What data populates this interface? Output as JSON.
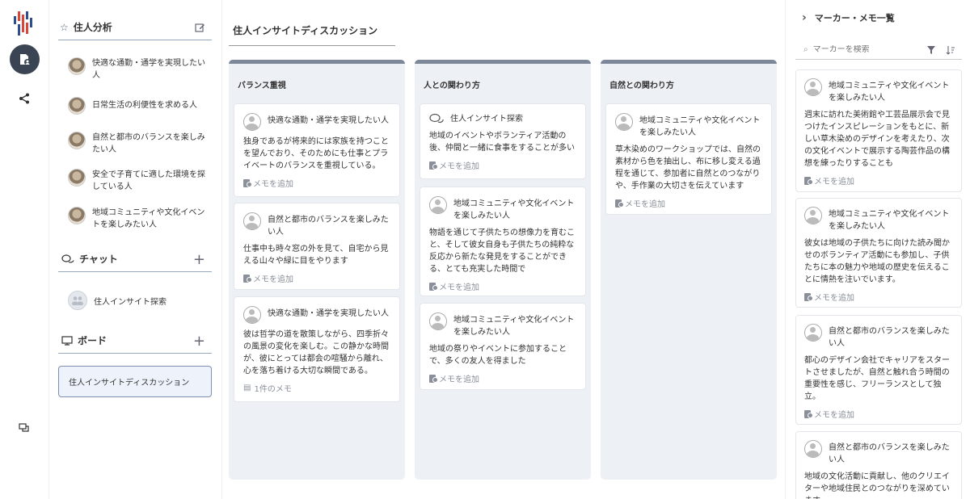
{
  "sidebar": {
    "persona_section_title": "住人分析",
    "personas": [
      {
        "label": "快適な通勤・通学を実現したい人"
      },
      {
        "label": "日常生活の利便性を求める人"
      },
      {
        "label": "自然と都市のバランスを楽しみたい人"
      },
      {
        "label": "安全で子育てに適した環境を探している人"
      },
      {
        "label": "地域コミュニティや文化イベントを楽しみたい人"
      }
    ],
    "chat_section_title": "チャット",
    "chat_item": "住人インサイト探索",
    "board_section_title": "ボード",
    "board_item": "住人インサイトディスカッション",
    "add_symbol": "+"
  },
  "board": {
    "title": "住人インサイトディスカッション",
    "columns": [
      {
        "title": "バランス重視",
        "cards": [
          {
            "name": "快適な通勤・通学を実現したい人",
            "body": "独身であるが将来的には家族を持つことを望んでおり、そのためにも仕事とプライベートのバランスを重視している。",
            "memo": "メモを追加"
          },
          {
            "name": "自然と都市のバランスを楽しみたい人",
            "body": "仕事中も時々窓の外を見て、自宅から見える山々や緑に目をやります",
            "memo": "メモを追加"
          },
          {
            "name": "快適な通勤・通学を実現したい人",
            "body": "彼は哲学の道を散策しながら、四季折々の風景の変化を楽しむ。この静かな時間が、彼にとっては都会の喧騒から離れ、心を落ち着ける大切な瞬間である。",
            "memo": "1件のメモ"
          }
        ]
      },
      {
        "title": "人との関わり方",
        "cards": [
          {
            "name": "住人インサイト探索",
            "body": "地域のイベントやボランティア活動の後、仲間と一緒に食事をすることが多い",
            "memo": "メモを追加"
          },
          {
            "name": "地域コミュニティや文化イベントを楽しみたい人",
            "body": "物語を通じて子供たちの想像力を育むこと、そして彼女自身も子供たちの純粋な反応から新たな発見をすることができる、とても充実した時間で",
            "memo": "メモを追加"
          },
          {
            "name": "地域コミュニティや文化イベントを楽しみたい人",
            "body": "地域の祭りやイベントに参加することで、多くの友人を得ました",
            "memo": "メモを追加"
          }
        ]
      },
      {
        "title": "自然との関わり方",
        "cards": [
          {
            "name": "地域コミュニティや文化イベントを楽しみたい人",
            "body": "草木染めのワークショップでは、自然の素材から色を抽出し、布に移し変える過程を通じて、参加者に自然とのつながりや、手作業の大切さを伝えています",
            "memo": "メモを追加"
          }
        ]
      }
    ]
  },
  "right_panel": {
    "title": "マーカー・メモ一覧",
    "search_placeholder": "マーカーを検索",
    "cards": [
      {
        "name": "地域コミュニティや文化イベントを楽しみたい人",
        "body": "週末に訪れた美術館や工芸品展示会で見つけたインスピレーションをもとに、新しい草木染めのデザインを考えたり、次の文化イベントで展示する陶芸作品の構想を練ったりすることも",
        "memo": "メモを追加"
      },
      {
        "name": "地域コミュニティや文化イベントを楽しみたい人",
        "body": "彼女は地域の子供たちに向けた読み聞かせのボランティア活動にも参加し、子供たちに本の魅力や地域の歴史を伝えることに情熱を注いでいます。",
        "memo": "メモを追加"
      },
      {
        "name": "自然と都市のバランスを楽しみたい人",
        "body": "都心のデザイン会社でキャリアをスタートさせましたが、自然と触れ合う時間の重要性を感じ、フリーランスとして独立。",
        "memo": "メモを追加"
      },
      {
        "name": "自然と都市のバランスを楽しみたい人",
        "body": "地域の文化活動に貢献し、他のクリエイターや地域住民とのつながりを深めています。",
        "memo": ""
      }
    ]
  },
  "colors": {
    "accent": "#3a4452",
    "column_bg": "#edf0f5",
    "column_top": "#7c8799",
    "selected_bg": "#eef3fb"
  }
}
